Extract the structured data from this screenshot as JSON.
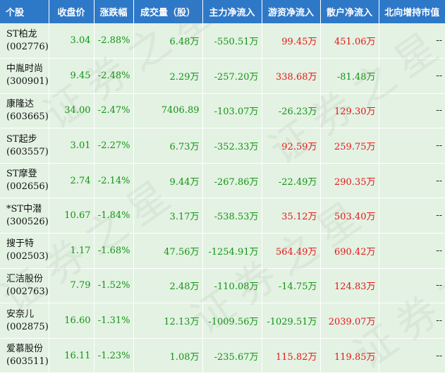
{
  "headers": [
    "个股",
    "收盘价",
    "涨跌幅",
    "成交量（股）",
    "主力净流入",
    "游资净流入",
    "散户净流入",
    "北向增持市值"
  ],
  "rows": [
    {
      "name": "ST柏龙",
      "code": "(002776)",
      "price": "3.04",
      "change": "-2.88%",
      "volume": "6.48万",
      "main": "-550.51万",
      "hot": "99.45万",
      "retail": "451.06万",
      "north": "--"
    },
    {
      "name": "中胤时尚",
      "code": "(300901)",
      "price": "9.45",
      "change": "-2.48%",
      "volume": "2.29万",
      "main": "-257.20万",
      "hot": "338.68万",
      "retail": "-81.48万",
      "north": "--"
    },
    {
      "name": "康隆达",
      "code": "(603665)",
      "price": "34.00",
      "change": "-2.47%",
      "volume": "7406.89",
      "main": "-103.07万",
      "hot": "-26.23万",
      "retail": "129.30万",
      "north": "--"
    },
    {
      "name": "ST起步",
      "code": "(603557)",
      "price": "3.01",
      "change": "-2.27%",
      "volume": "6.73万",
      "main": "-352.33万",
      "hot": "92.59万",
      "retail": "259.75万",
      "north": "--"
    },
    {
      "name": "ST摩登",
      "code": "(002656)",
      "price": "2.74",
      "change": "-2.14%",
      "volume": "9.44万",
      "main": "-267.86万",
      "hot": "-22.49万",
      "retail": "290.35万",
      "north": "--"
    },
    {
      "name": "*ST中潜",
      "code": "(300526)",
      "price": "10.67",
      "change": "-1.84%",
      "volume": "3.17万",
      "main": "-538.53万",
      "hot": "35.12万",
      "retail": "503.40万",
      "north": "--"
    },
    {
      "name": "搜于特",
      "code": "(002503)",
      "price": "1.17",
      "change": "-1.68%",
      "volume": "47.56万",
      "main": "-1254.91万",
      "hot": "564.49万",
      "retail": "690.42万",
      "north": "--"
    },
    {
      "name": "汇洁股份",
      "code": "(002763)",
      "price": "7.79",
      "change": "-1.52%",
      "volume": "2.48万",
      "main": "-110.08万",
      "hot": "-14.75万",
      "retail": "124.83万",
      "north": "--"
    },
    {
      "name": "安奈儿",
      "code": "(002875)",
      "price": "16.60",
      "change": "-1.31%",
      "volume": "12.13万",
      "main": "-1009.56万",
      "hot": "-1029.51万",
      "retail": "2039.07万",
      "north": "--"
    },
    {
      "name": "爱慕股份",
      "code": "(603511)",
      "price": "16.11",
      "change": "-1.23%",
      "volume": "1.08万",
      "main": "-235.67万",
      "hot": "115.82万",
      "retail": "119.85万",
      "north": "--"
    }
  ],
  "watermark": "证券之星",
  "colors": {
    "header_bg": "#2e78c8",
    "row_bg": "#e3f2e3",
    "positive": "#e61717",
    "negative": "#139413"
  }
}
